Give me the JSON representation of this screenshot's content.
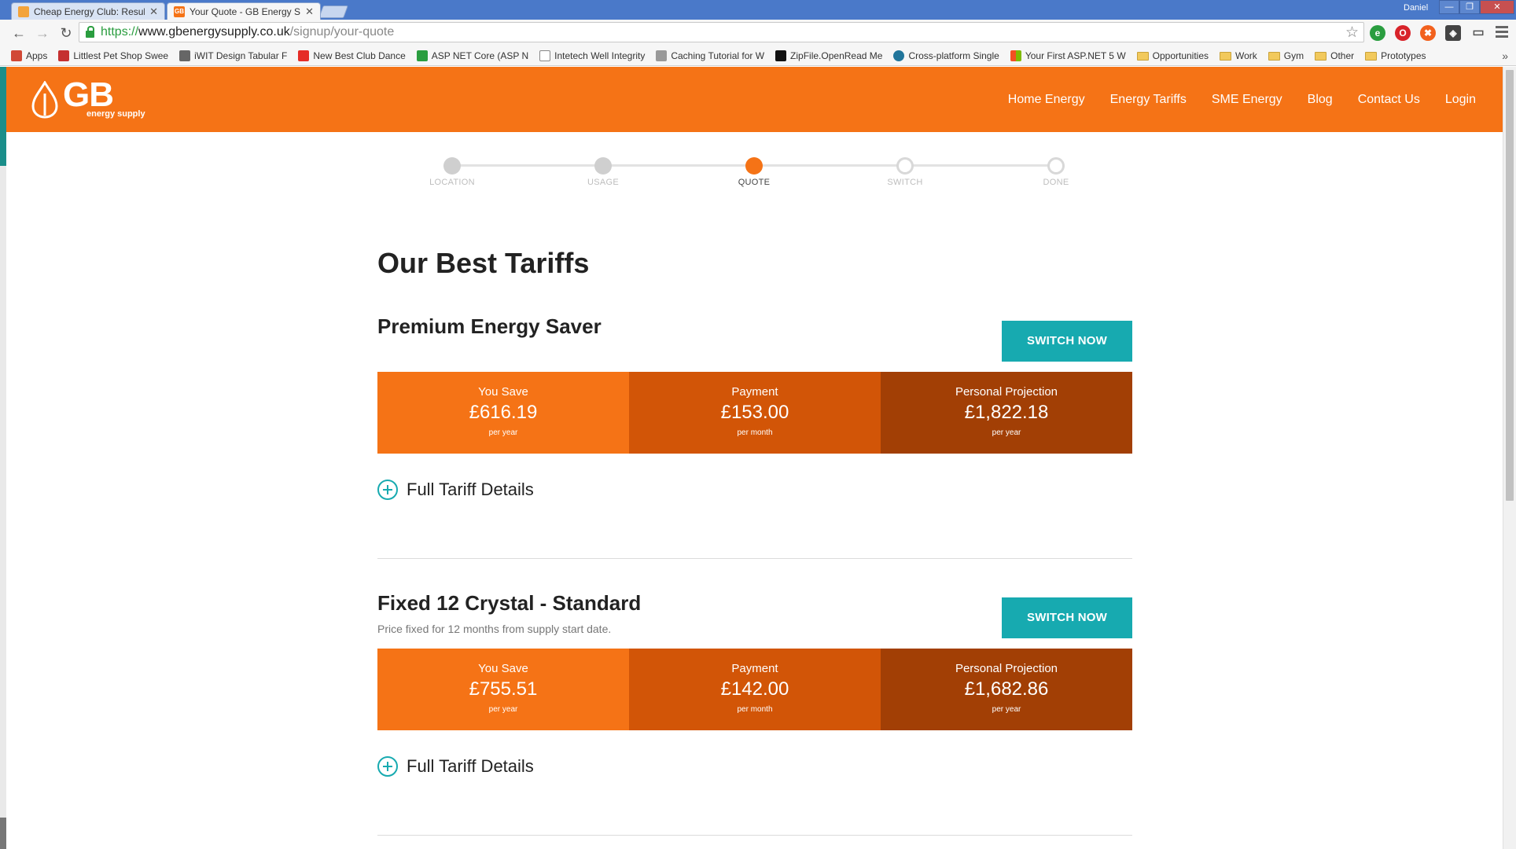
{
  "browser": {
    "tabs": [
      {
        "title": "Cheap Energy Club: Resul",
        "active": false
      },
      {
        "title": "Your Quote - GB Energy S",
        "active": true
      }
    ],
    "user": "Daniel",
    "url": {
      "scheme": "https://",
      "host": "www.gbenergysupply.co.uk",
      "path": "/signup/your-quote"
    },
    "bookmarks": [
      {
        "label": "Apps",
        "icon": "apps-grid-icon",
        "color": "#d14836"
      },
      {
        "label": "Littlest Pet Shop Swee",
        "icon": "pet-shop-icon",
        "color": "#c53030"
      },
      {
        "label": "iWIT Design Tabular F",
        "icon": "chart-icon",
        "color": "#666666"
      },
      {
        "label": "New Best Club Dance",
        "icon": "youtube-icon",
        "color": "#e52d27"
      },
      {
        "label": "ASP NET Core (ASP N",
        "icon": "u-icon",
        "color": "#2a9d3f"
      },
      {
        "label": "Intetech Well Integrity",
        "icon": "page-icon",
        "color": "#888888"
      },
      {
        "label": "Caching Tutorial for W",
        "icon": "lock-icon",
        "color": "#999999"
      },
      {
        "label": "ZipFile.OpenRead Me",
        "icon": "m-icon",
        "color": "#111111"
      },
      {
        "label": "Cross-platform Single",
        "icon": "wordpress-icon",
        "color": "#21759b"
      },
      {
        "label": "Your First ASP.NET 5 W",
        "icon": "windows-icon",
        "color": "#f25022"
      },
      {
        "label": "Opportunities",
        "icon": "folder-icon"
      },
      {
        "label": "Work",
        "icon": "folder-icon"
      },
      {
        "label": "Gym",
        "icon": "folder-icon"
      },
      {
        "label": "Other",
        "icon": "folder-icon"
      },
      {
        "label": "Prototypes",
        "icon": "folder-icon"
      }
    ],
    "overflow": "»"
  },
  "site": {
    "logo": {
      "mark": "GB",
      "sub": "energy supply"
    },
    "nav": [
      "Home Energy",
      "Energy Tariffs",
      "SME Energy",
      "Blog",
      "Contact Us",
      "Login"
    ],
    "colors": {
      "brand": "#f57316",
      "accent": "#17aab0"
    }
  },
  "steps": [
    {
      "label": "LOCATION",
      "state": "done"
    },
    {
      "label": "USAGE",
      "state": "done"
    },
    {
      "label": "QUOTE",
      "state": "current"
    },
    {
      "label": "SWITCH",
      "state": "todo"
    },
    {
      "label": "DONE",
      "state": "todo"
    }
  ],
  "main": {
    "title": "Our Best Tariffs",
    "tariffs": [
      {
        "name": "Premium Energy Saver",
        "description": "",
        "switch_label": "SWITCH NOW",
        "stats": [
          {
            "label": "You Save",
            "value": "£616.19",
            "unit": "per year"
          },
          {
            "label": "Payment",
            "value": "£153.00",
            "unit": "per month"
          },
          {
            "label": "Personal Projection",
            "value": "£1,822.18",
            "unit": "per year"
          }
        ],
        "details_label": "Full Tariff Details"
      },
      {
        "name": "Fixed 12 Crystal - Standard",
        "description": "Price fixed for 12 months from supply start date.",
        "switch_label": "SWITCH NOW",
        "stats": [
          {
            "label": "You Save",
            "value": "£755.51",
            "unit": "per year"
          },
          {
            "label": "Payment",
            "value": "£142.00",
            "unit": "per month"
          },
          {
            "label": "Personal Projection",
            "value": "£1,682.86",
            "unit": "per year"
          }
        ],
        "details_label": "Full Tariff Details"
      }
    ]
  }
}
